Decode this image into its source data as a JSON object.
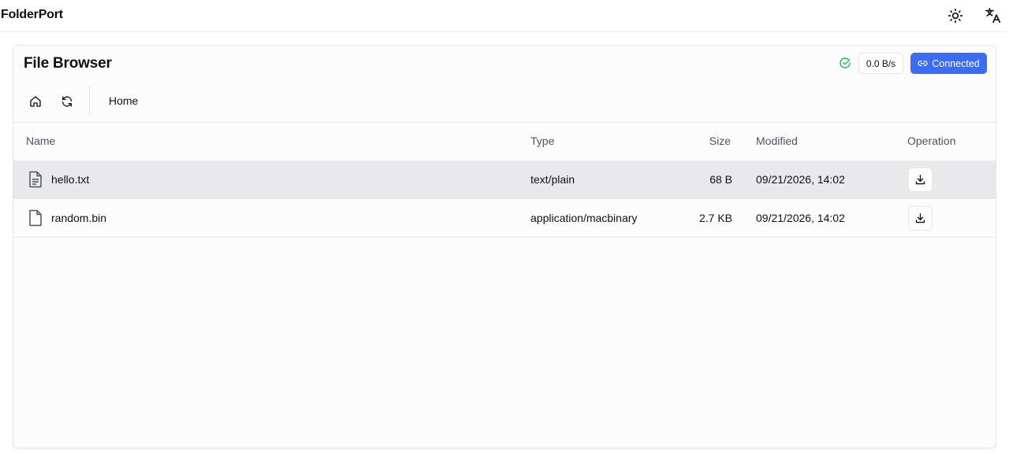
{
  "app": {
    "title": "FolderPort"
  },
  "topbar": {
    "theme_icon": "sun-icon",
    "language_icon": "translate-icon"
  },
  "browser": {
    "title": "File Browser",
    "status_icon": "check-circle-icon",
    "speed": "0.0 B/s",
    "connection_label": "Connected",
    "colors": {
      "accent": "#3b6cf6",
      "ok": "#22c55e",
      "row_highlight": "#e9e9ec"
    },
    "toolbar": {
      "home_icon": "home-icon",
      "refresh_icon": "refresh-icon"
    },
    "breadcrumb": [
      "Home"
    ]
  },
  "table": {
    "columns": [
      "Name",
      "Type",
      "Size",
      "Modified",
      "Operation"
    ],
    "rows": [
      {
        "name": "hello.txt",
        "type": "text/plain",
        "size": "68 B",
        "modified": "09/21/2026, 14:02",
        "icon": "text-file-icon"
      },
      {
        "name": "random.bin",
        "type": "application/macbinary",
        "size": "2.7 KB",
        "modified": "09/21/2026, 14:02",
        "icon": "file-icon"
      }
    ]
  }
}
